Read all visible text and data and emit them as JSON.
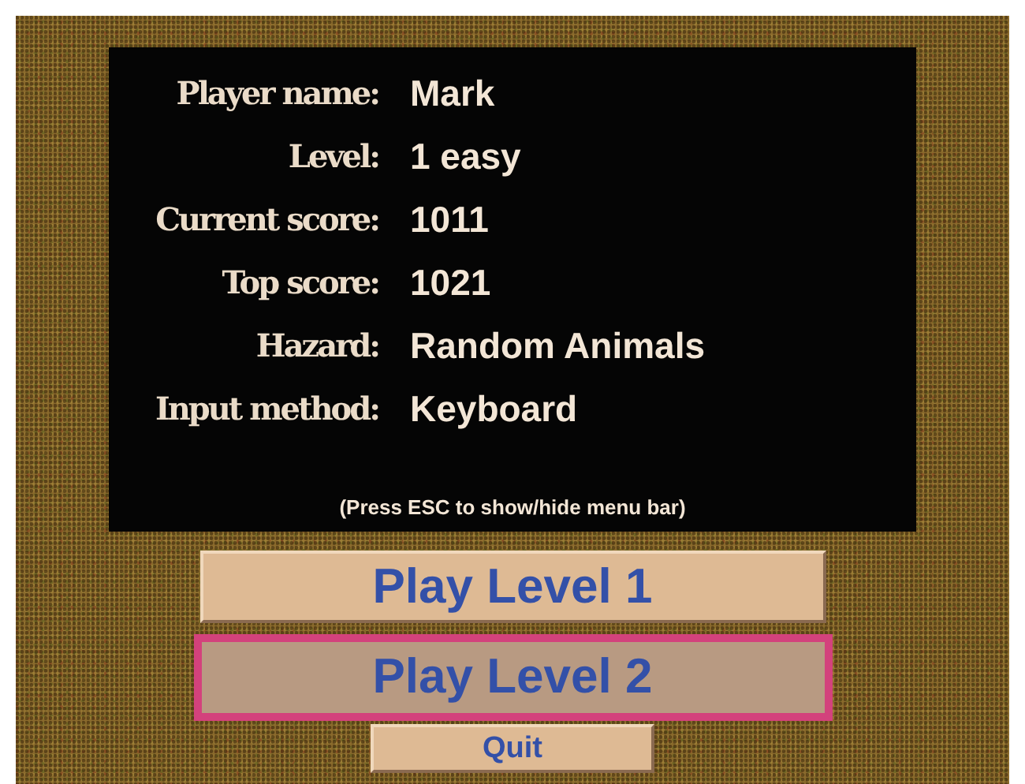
{
  "info": [
    {
      "label": "Player name:",
      "value": "Mark"
    },
    {
      "label": "Level:",
      "value": "1 easy"
    },
    {
      "label": "Current score:",
      "value": "1011"
    },
    {
      "label": "Top score:",
      "value": "1021"
    },
    {
      "label": "Hazard:",
      "value": "Random Animals"
    },
    {
      "label": "Input method:",
      "value": "Keyboard"
    }
  ],
  "hint": "(Press ESC to show/hide menu bar)",
  "buttons": [
    {
      "label": "Play Level 1",
      "kind": "large",
      "selected": false
    },
    {
      "label": "Play Level 2",
      "kind": "large",
      "selected": true
    },
    {
      "label": "Quit",
      "kind": "small",
      "selected": false
    }
  ]
}
